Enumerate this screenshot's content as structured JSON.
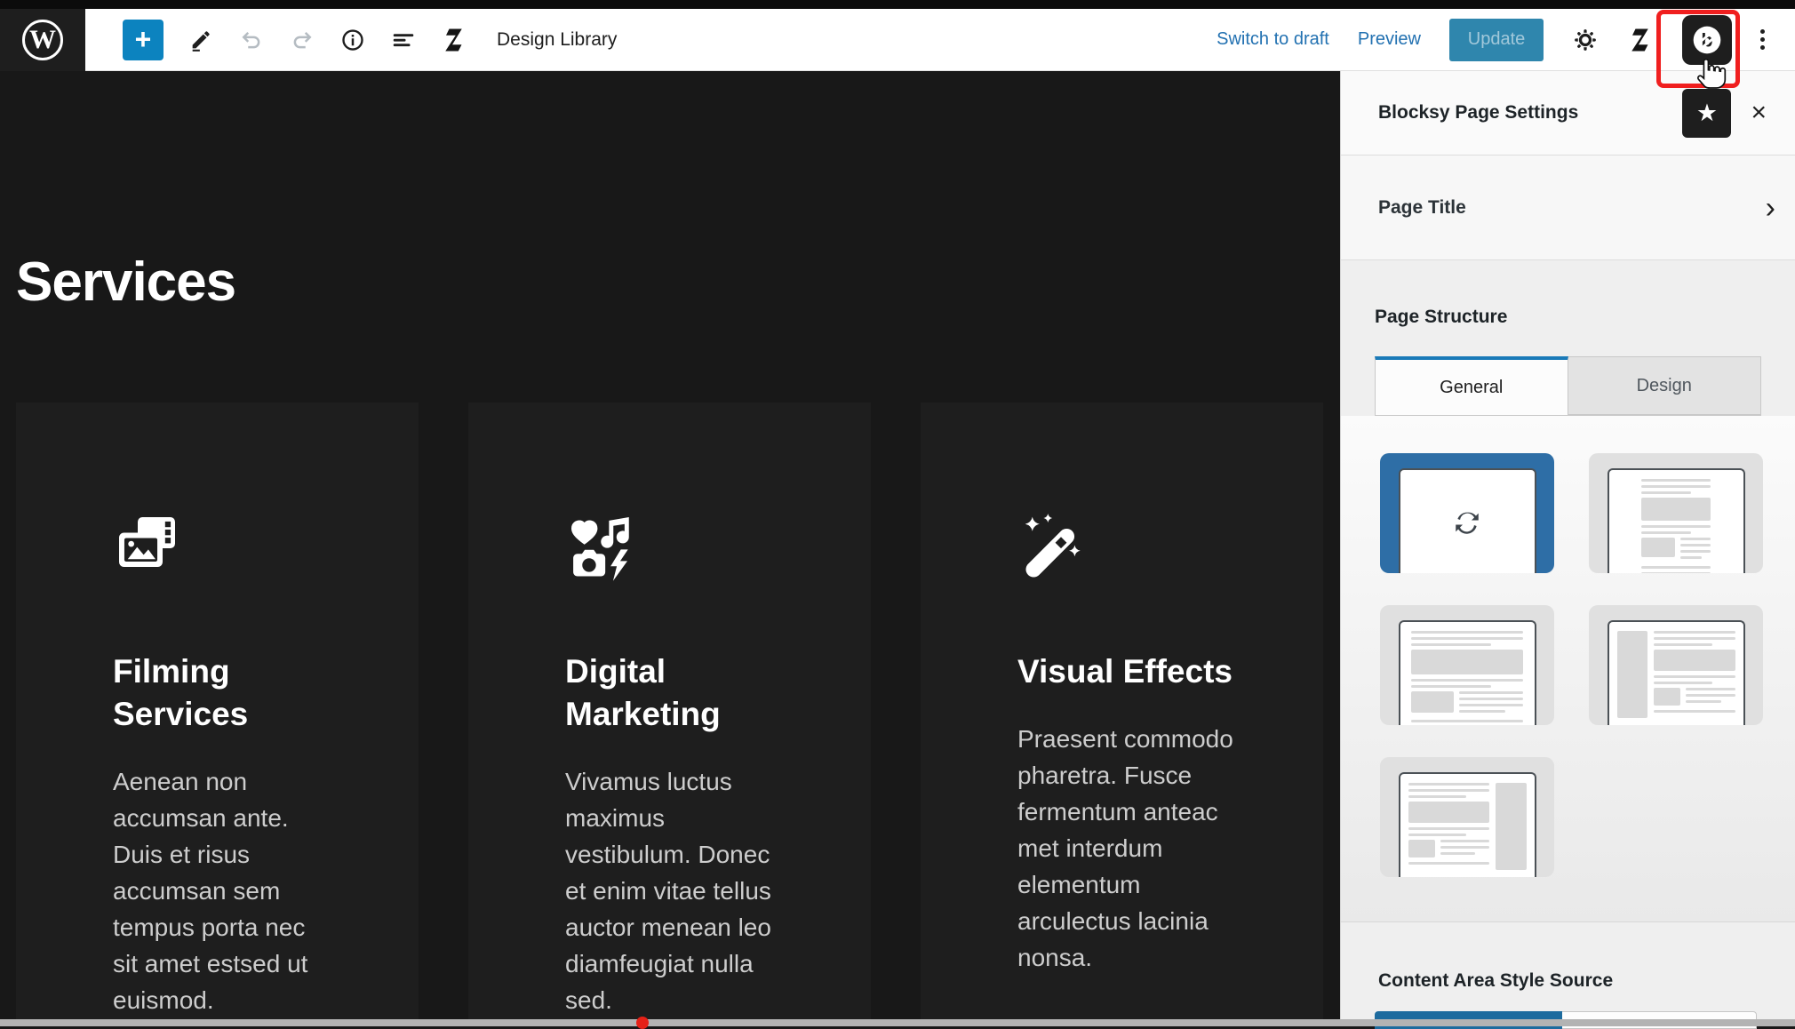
{
  "toolbar": {
    "design_library": "Design Library",
    "switch_to_draft": "Switch to draft",
    "preview": "Preview",
    "update": "Update",
    "add_block_glyph": "+"
  },
  "canvas": {
    "heading": "Services",
    "cards": [
      {
        "icon": "film-photo-icon",
        "title": "Filming\nServices",
        "body": "Aenean non\naccumsan ante.\nDuis et risus\naccumsan sem\ntempus porta nec\nsit amet estsed ut\neuismod."
      },
      {
        "icon": "social-media-icon",
        "title": "Digital\nMarketing",
        "body": "Vivamus luctus\nmaximus\nvestibulum. Donec\net enim vitae tellus\nauctor menean leo\ndiamfeugiat nulla\nsed."
      },
      {
        "icon": "magic-wand-icon",
        "title": "Visual Effects",
        "body": "Praesent commodo\npharetra. Fusce\nfermentum anteac\nmet interdum\nelementum\narculectus lacinia\nnonsa."
      }
    ]
  },
  "panel": {
    "title": "Blocksy Page Settings",
    "star_glyph": "★",
    "close_glyph": "×",
    "chevron_glyph": "›",
    "page_title_label": "Page Title",
    "page_structure_label": "Page Structure",
    "tabs": {
      "general": "General",
      "design": "Design"
    },
    "structure_options": [
      "inherit-from-customizer (selected)",
      "narrow-content-width",
      "normal-content-width",
      "left-sidebar",
      "right-sidebar"
    ],
    "content_area_label": "Content Area Style Source"
  },
  "colors": {
    "wp_blue": "#0c83bf",
    "link_blue": "#2271b1",
    "selected_option_blue": "#2e6ea6",
    "tab_accent_blue": "#1a7ab8",
    "highlight_red": "#f01f1f",
    "canvas_bg": "#181818",
    "card_bg": "#1e1e1e",
    "playhead_red": "#e62117"
  }
}
